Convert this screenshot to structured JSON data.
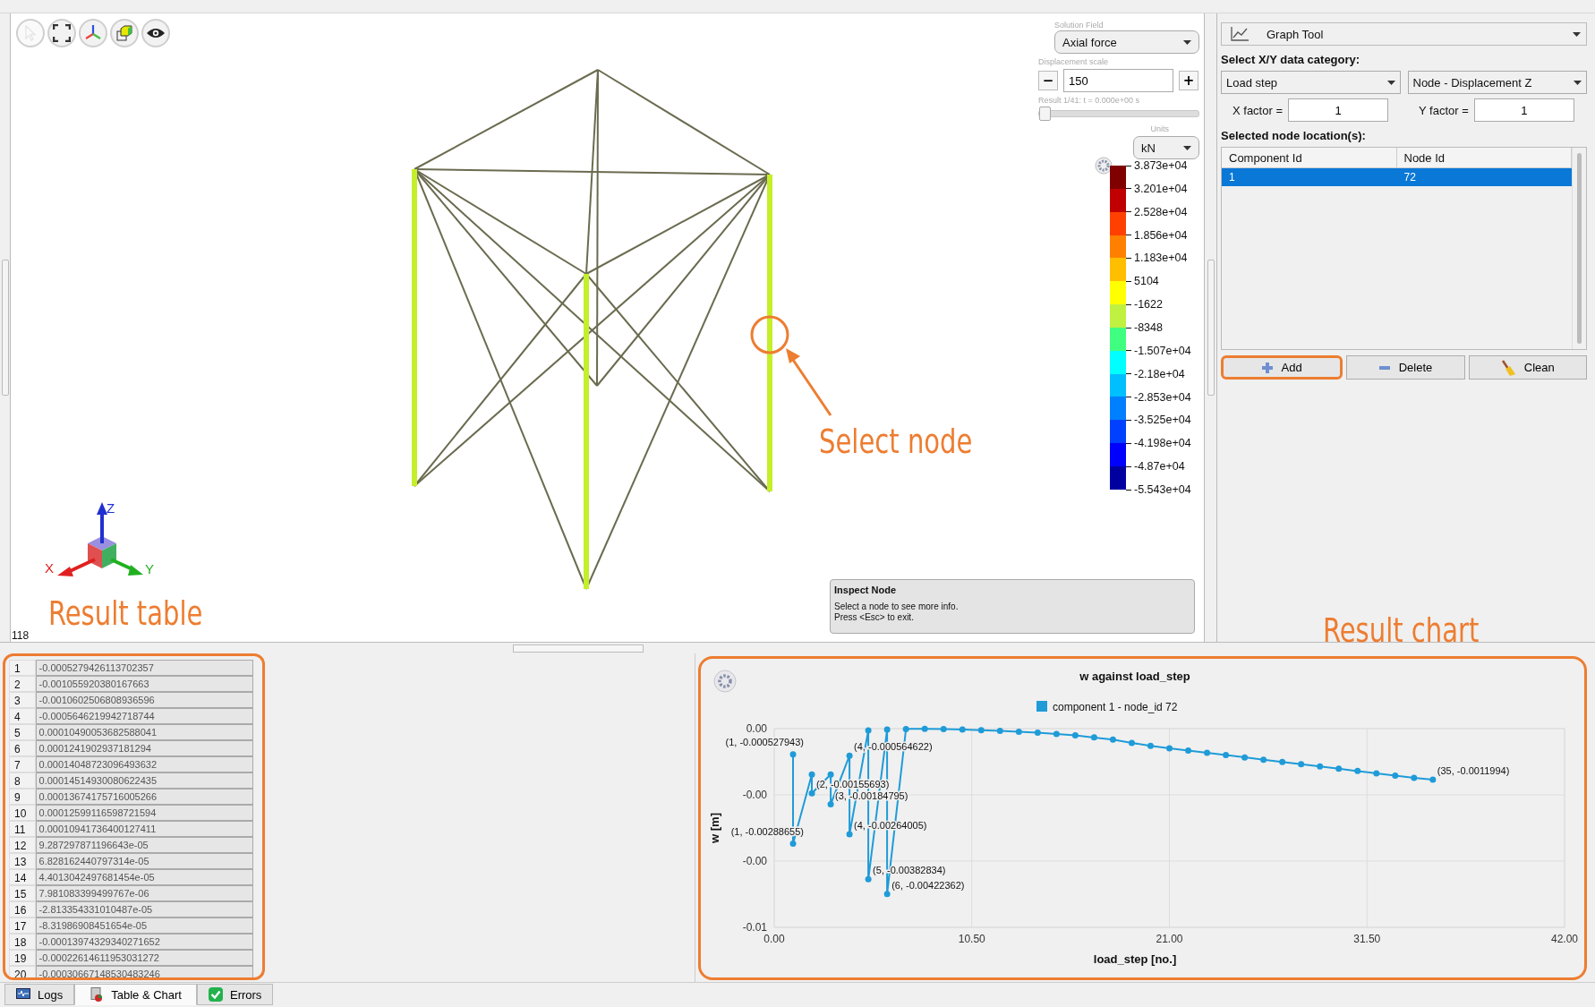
{
  "viewport": {
    "toolbar": [
      {
        "kind": "pointer",
        "disabled": true
      },
      {
        "kind": "fit",
        "disabled": false
      },
      {
        "kind": "axes",
        "disabled": false
      },
      {
        "kind": "cube",
        "disabled": false
      },
      {
        "kind": "eye",
        "disabled": false
      }
    ],
    "solution_field": {
      "label": "Solution Field",
      "value": "Axial force"
    },
    "displacement_scale": {
      "label": "Displacement scale",
      "minus": "−",
      "value": "150",
      "plus": "+"
    },
    "result_slider": {
      "label": "Result 1/41: t = 0.000e+00 s",
      "level": 0
    },
    "units": {
      "label": "Units",
      "value": "kN"
    },
    "legend": {
      "bands": [
        {
          "color": "#800000"
        },
        {
          "color": "#c00000"
        },
        {
          "color": "#ff4000"
        },
        {
          "color": "#ff8000"
        },
        {
          "color": "#ffbf00"
        },
        {
          "color": "#ffff00"
        },
        {
          "color": "#c0f040"
        },
        {
          "color": "#40ff80"
        },
        {
          "color": "#00ffff"
        },
        {
          "color": "#00bfff"
        },
        {
          "color": "#0080ff"
        },
        {
          "color": "#0040ff"
        },
        {
          "color": "#0000ff"
        },
        {
          "color": "#0000a0"
        }
      ],
      "ticks": [
        "3.873e+04",
        "3.201e+04",
        "2.528e+04",
        "1.856e+04",
        "1.183e+04",
        "5104",
        "-1622",
        "-8348",
        "-1.507e+04",
        "-2.18e+04",
        "-2.853e+04",
        "-3.525e+04",
        "-4.198e+04",
        "-4.87e+04",
        "-5.543e+04"
      ]
    },
    "axes": {
      "x": "X",
      "y": "Y",
      "z": "Z"
    },
    "inspect_panel": {
      "title": "Inspect Node",
      "lines": [
        "Select a node to see more info.",
        "Press <Esc> to exit."
      ]
    },
    "frame_counter": "118"
  },
  "annotations": {
    "select_node": "Select node",
    "result_table": "Result table",
    "result_chart": "Result chart"
  },
  "graph_tool": {
    "title": "Graph Tool",
    "category_label": "Select X/Y data category:",
    "x_category": "Load step",
    "y_category": "Node - Displacement Z",
    "x_factor_label": "X factor =",
    "x_factor": "1",
    "y_factor_label": "Y factor =",
    "y_factor": "1",
    "nodes_label": "Selected node location(s):",
    "columns": [
      "Component Id",
      "Node Id"
    ],
    "rows": [
      {
        "cells": [
          "1",
          "72"
        ],
        "selected": true
      }
    ],
    "buttons": [
      {
        "kind": "add",
        "label": "Add",
        "highlighted": true
      },
      {
        "kind": "delete",
        "label": "Delete",
        "highlighted": false
      },
      {
        "kind": "clean",
        "label": "Clean",
        "highlighted": false
      }
    ]
  },
  "result_table": {
    "highlighted": true,
    "rows": [
      {
        "index": "1",
        "value": "-0.0005279426113702357"
      },
      {
        "index": "2",
        "value": "-0.001055920380167663"
      },
      {
        "index": "3",
        "value": "-0.0010602506808936596"
      },
      {
        "index": "4",
        "value": "-0.0005646219942718744"
      },
      {
        "index": "5",
        "value": "0.00010490053682588041"
      },
      {
        "index": "6",
        "value": "0.0001241902937181294"
      },
      {
        "index": "7",
        "value": "0.00014048723096493632"
      },
      {
        "index": "8",
        "value": "0.00014514930080622435"
      },
      {
        "index": "9",
        "value": "0.00013674175716005266"
      },
      {
        "index": "10",
        "value": "0.00012599116598721594"
      },
      {
        "index": "11",
        "value": "0.00010941736400127411"
      },
      {
        "index": "12",
        "value": "9.287297871196643e-05"
      },
      {
        "index": "13",
        "value": "6.828162440797314e-05"
      },
      {
        "index": "14",
        "value": "4.4013042497681454e-05"
      },
      {
        "index": "15",
        "value": "7.981083399499767e-06"
      },
      {
        "index": "16",
        "value": "-2.813354331010487e-05"
      },
      {
        "index": "17",
        "value": "-8.31986908451654e-05"
      },
      {
        "index": "18",
        "value": "-0.00013974329340271652"
      },
      {
        "index": "19",
        "value": "-0.00022614611953031272"
      },
      {
        "index": "20",
        "value": "-0.00030667148530483246"
      }
    ]
  },
  "result_chart": {
    "highlighted": true,
    "chart_data": {
      "type": "line",
      "title": "w against load_step",
      "xlabel": "load_step [no.]",
      "ylabel": "w [m]",
      "x": [
        1,
        1,
        2,
        2,
        3,
        3,
        4,
        4,
        5,
        5,
        6,
        6,
        7,
        8,
        9,
        10,
        11,
        12,
        13,
        14,
        15,
        16,
        17,
        18,
        19,
        20,
        21,
        22,
        23,
        24,
        25,
        26,
        27,
        28,
        29,
        30,
        31,
        32,
        33,
        34,
        35
      ],
      "grid": true,
      "series": [
        {
          "name": "component 1 - node_id 72",
          "color": "#1f9bd8",
          "marker": "circle",
          "values": [
            -0.000528,
            -0.00289,
            -0.00106,
            -0.00156,
            -0.00106,
            -0.00185,
            -0.000565,
            -0.00264,
            0.000105,
            -0.00383,
            0.000124,
            -0.00422,
            0.00014,
            0.000145,
            0.000137,
            0.000126,
            0.000109,
            9.29e-05,
            6.83e-05,
            4.4e-05,
            8e-06,
            -2.8e-05,
            -8.3e-05,
            -0.00014,
            -0.000226,
            -0.000307,
            -0.00037,
            -0.00043,
            -0.00049,
            -0.00055,
            -0.00061,
            -0.00067,
            -0.00073,
            -0.00079,
            -0.00085,
            -0.00091,
            -0.00097,
            -0.00103,
            -0.00109,
            -0.00115,
            -0.0012
          ]
        }
      ],
      "xlim": [
        0,
        42
      ],
      "ylim": [
        -0.0051,
        0.00015
      ],
      "xticks": [
        {
          "value": 0,
          "label": "0.00"
        },
        {
          "value": 10.5,
          "label": "10.50"
        },
        {
          "value": 21,
          "label": "21.00"
        },
        {
          "value": 31.5,
          "label": "31.50"
        },
        {
          "value": 42,
          "label": "42.00"
        }
      ],
      "yticks": [
        {
          "value": 0.00015,
          "label": "0.00"
        },
        {
          "value": -0.0016,
          "label": "-0.00"
        },
        {
          "value": -0.00335,
          "label": "-0.00"
        },
        {
          "value": -0.0051,
          "label": "-0.01"
        }
      ],
      "annotations": [
        {
          "x": 1,
          "y": -0.000528,
          "text": "(1, -0.000527943)"
        },
        {
          "x": 4,
          "y": -0.000565,
          "text": "(4, -0.000564622)"
        },
        {
          "x": 2,
          "y": -0.00156,
          "text": "(2, -0.00155693)"
        },
        {
          "x": 3,
          "y": -0.00185,
          "text": "(3, -0.00184795)"
        },
        {
          "x": 4,
          "y": -0.00264,
          "text": "(4, -0.00264005)"
        },
        {
          "x": 1,
          "y": -0.00289,
          "text": "(1, -0.00288655)"
        },
        {
          "x": 5,
          "y": -0.00383,
          "text": "(5, -0.00382834)"
        },
        {
          "x": 6,
          "y": -0.00422,
          "text": "(6, -0.00422362)"
        },
        {
          "x": 35,
          "y": -0.0012,
          "text": "(35, -0.0011994)"
        }
      ]
    }
  },
  "bottom_tabs": [
    {
      "kind": "logs",
      "label": "Logs",
      "selected": false
    },
    {
      "kind": "table_chart",
      "label": "Table & Chart",
      "selected": true
    },
    {
      "kind": "errors",
      "label": "Errors",
      "selected": false
    }
  ]
}
